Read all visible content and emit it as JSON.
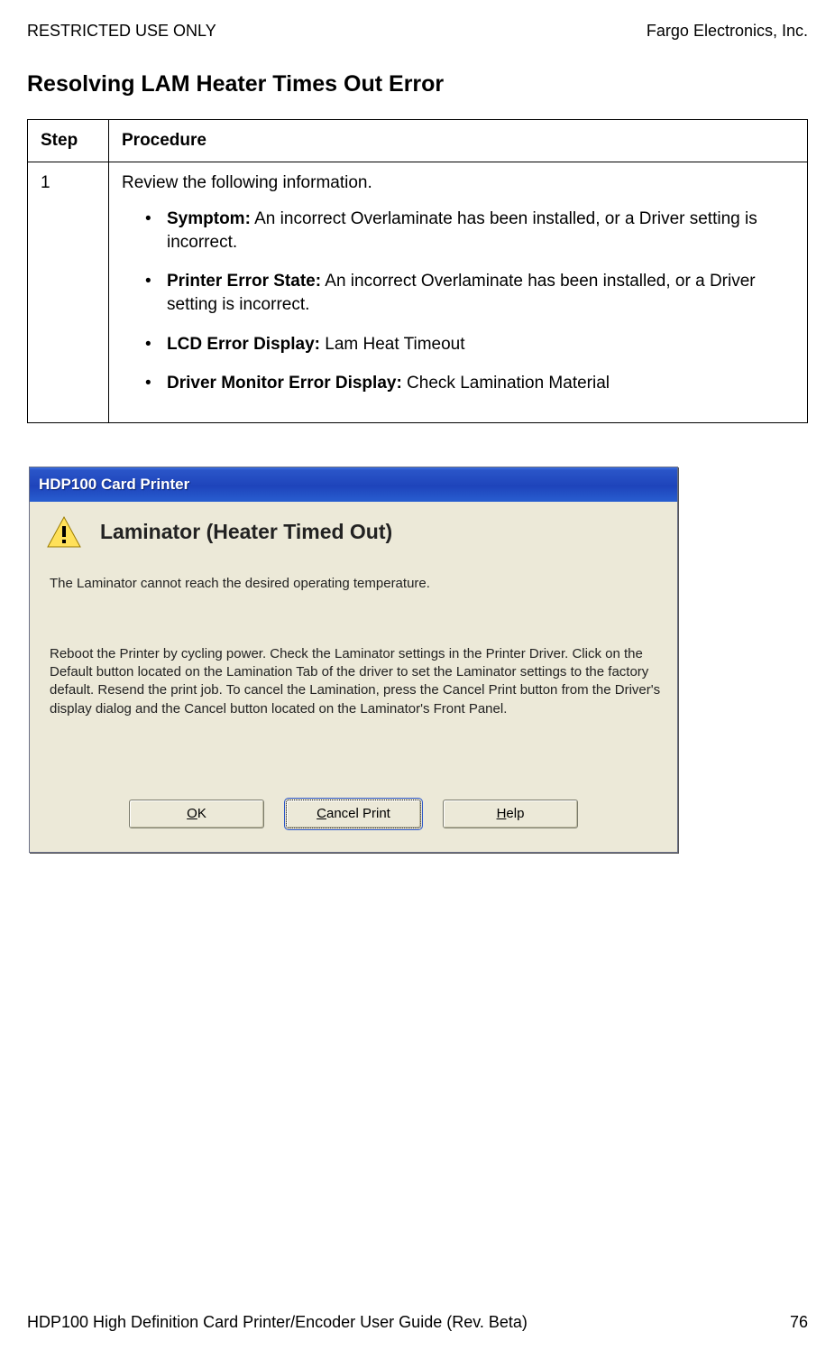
{
  "header": {
    "left": "RESTRICTED USE ONLY",
    "right": "Fargo Electronics, Inc."
  },
  "section_title": "Resolving LAM Heater Times Out Error",
  "table": {
    "head_step": "Step",
    "head_proc": "Procedure",
    "row1": {
      "step": "1",
      "intro": "Review the following information.",
      "items": {
        "symptom_label": "Symptom:",
        "symptom_text": "   An incorrect Overlaminate has been installed, or a Driver setting is incorrect.",
        "pes_label": "Printer Error State:",
        "pes_text": "  An incorrect Overlaminate has been installed, or a Driver setting is incorrect.",
        "lcd_label": "LCD Error Display:",
        "lcd_text": "  Lam Heat Timeout",
        "dme_label": "Driver Monitor Error Display:",
        "dme_text": "  Check Lamination Material"
      }
    }
  },
  "dialog": {
    "title": "HDP100 Card Printer",
    "heading": "Laminator (Heater Timed Out)",
    "text1": "The Laminator cannot reach the desired operating temperature.",
    "text2": "Reboot the Printer by cycling power. Check the Laminator settings in the Printer Driver. Click on the Default button located on the Lamination Tab of the driver to set the Laminator settings to the factory default. Resend the print job. To cancel the Lamination, press the Cancel Print button from the Driver's display dialog and the Cancel button located on the Laminator's Front Panel.",
    "buttons": {
      "ok_pre": "O",
      "ok_rest": "K",
      "cancel_pre": "C",
      "cancel_rest": "ancel Print",
      "help_pre": "H",
      "help_rest": "elp"
    }
  },
  "footer": {
    "left": "HDP100 High Definition Card Printer/Encoder User Guide (Rev. Beta)",
    "page": "76"
  }
}
